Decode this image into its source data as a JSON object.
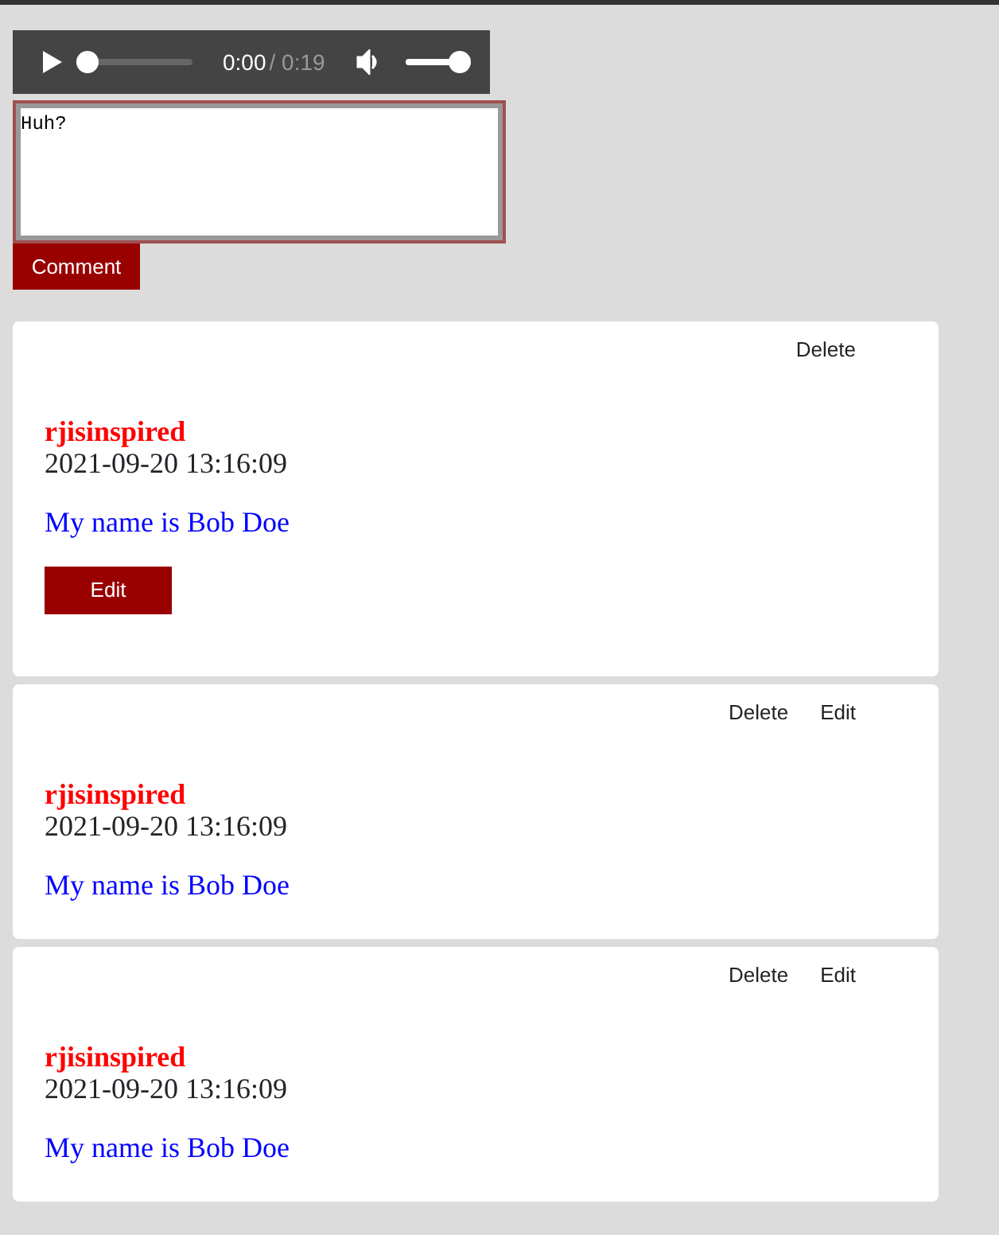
{
  "audio_player": {
    "current_time": "0:00",
    "duration": "/ 0:19",
    "progress": {
      "level": 0
    },
    "volume": {
      "level": 1
    }
  },
  "comment_box": {
    "value": "Huh?"
  },
  "comment_button": "Comment",
  "comments": [
    {
      "author": "rjisinspired",
      "timestamp": "2021-09-20 13:16:09",
      "text": "My name is Bob Doe",
      "delete_label": "Delete",
      "edit_label": "Edit",
      "editing": true
    },
    {
      "author": "rjisinspired",
      "timestamp": "2021-09-20 13:16:09",
      "text": "My name is Bob Doe",
      "delete_label": "Delete",
      "edit_label": "Edit",
      "editing": false
    },
    {
      "author": "rjisinspired",
      "timestamp": "2021-09-20 13:16:09",
      "text": "My name is Bob Doe",
      "delete_label": "Delete",
      "edit_label": "Edit",
      "editing": false
    }
  ]
}
